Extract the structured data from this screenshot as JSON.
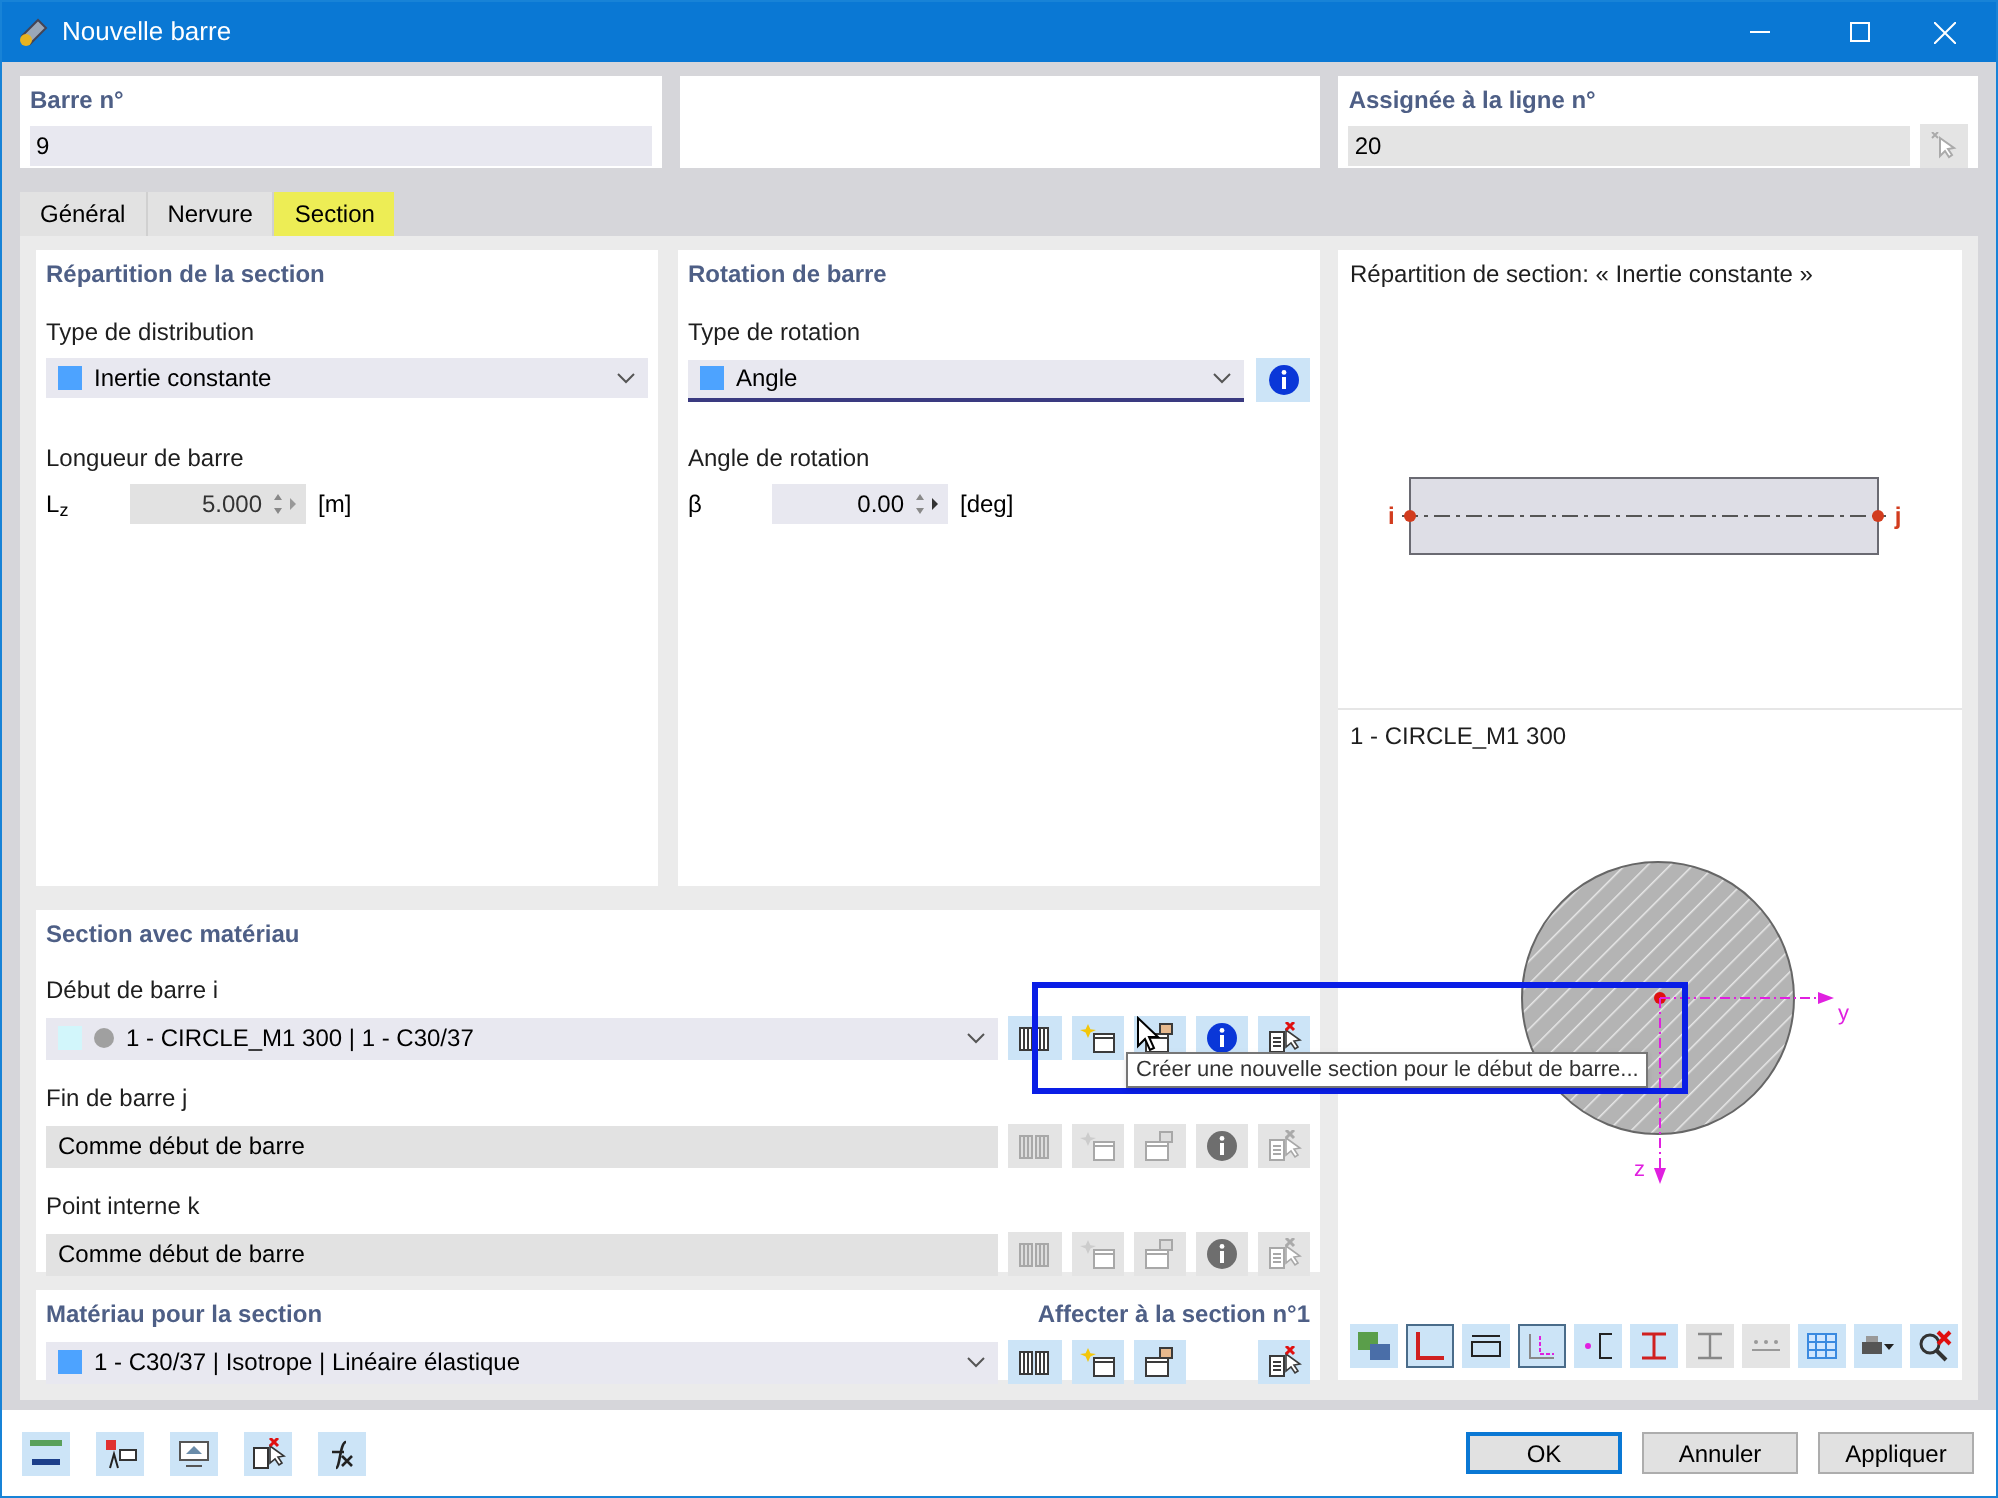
{
  "window": {
    "title": "Nouvelle barre"
  },
  "header": {
    "member": {
      "label": "Barre n°",
      "value": "9"
    },
    "line": {
      "label": "Assignée à la ligne n°",
      "value": "20"
    }
  },
  "tabs": [
    {
      "label": "Général",
      "selected": false
    },
    {
      "label": "Nervure",
      "selected": false
    },
    {
      "label": "Section",
      "selected": true
    }
  ],
  "distribution": {
    "title": "Répartition de la section",
    "type_label": "Type de distribution",
    "type_value": "Inertie constante",
    "length_label": "Longueur de barre",
    "symbol": "L$_{z}$",
    "value": "5.000",
    "unit": "[m]"
  },
  "rotation": {
    "title": "Rotation de barre",
    "type_label": "Type de rotation",
    "type_value": "Angle",
    "angle_label": "Angle de rotation",
    "symbol": "β",
    "value": "0.00",
    "unit": "[deg]"
  },
  "section_material": {
    "title": "Section avec matériau",
    "rows": [
      {
        "label": "Début de barre i",
        "value": "1 - CIRCLE_M1 300 | 1 - C30/37",
        "disabled": false
      },
      {
        "label": "Fin de barre j",
        "value": "Comme début de barre",
        "disabled": true
      },
      {
        "label": "Point interne k",
        "value": "Comme début de barre",
        "disabled": true
      }
    ],
    "tooltip": "Créer une nouvelle section pour le début de barre..."
  },
  "material": {
    "title": "Matériau pour la section",
    "assign": "Affecter à la section n°1",
    "value": "1 - C30/37 | Isotrope | Linéaire élastique"
  },
  "preview": {
    "title": "Répartition de section: « Inertie constante »",
    "end_i": "i",
    "end_j": "j",
    "section_name": "1 - CIRCLE_M1 300",
    "axis_y": "y",
    "axis_z": "z"
  },
  "buttons": [
    {
      "label": "OK",
      "default": true
    },
    {
      "label": "Annuler",
      "default": false
    },
    {
      "label": "Appliquer",
      "default": false
    }
  ]
}
